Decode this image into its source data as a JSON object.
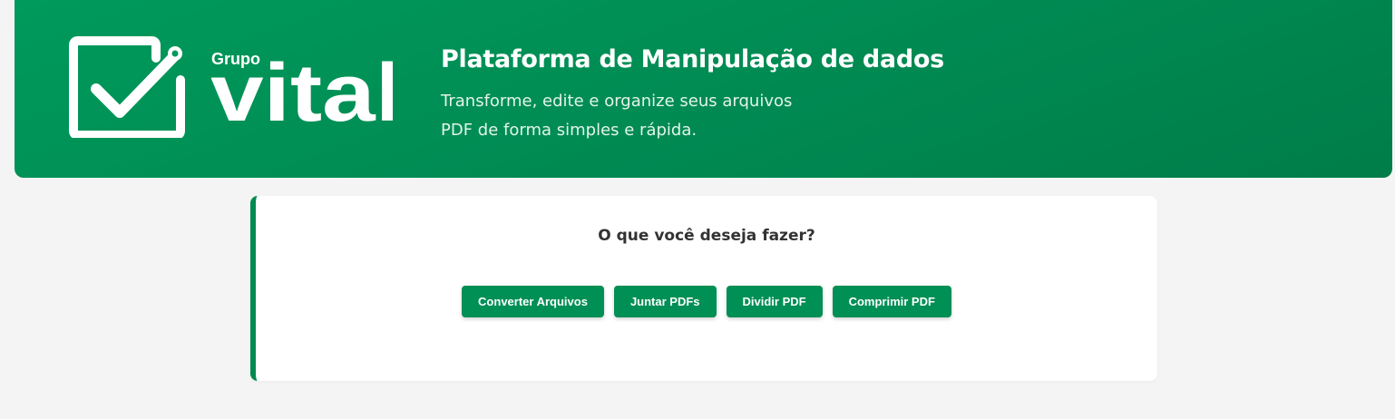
{
  "header": {
    "brand_small": "Grupo",
    "brand_large": "vital",
    "title": "Plataforma de Manipulação de dados",
    "subtitle_line1": "Transforme, edite e organize seus arquivos",
    "subtitle_line2": "PDF de forma simples e rápida."
  },
  "card": {
    "question": "O que você deseja fazer?",
    "actions": [
      {
        "label": "Converter Arquivos"
      },
      {
        "label": "Juntar PDFs"
      },
      {
        "label": "Dividir PDF"
      },
      {
        "label": "Comprimir PDF"
      }
    ]
  },
  "colors": {
    "brand_green": "#008a52",
    "button_green": "#008f55",
    "background": "#f4f4f4"
  },
  "icons": {
    "logo_mark": "checkbox-check-icon"
  }
}
